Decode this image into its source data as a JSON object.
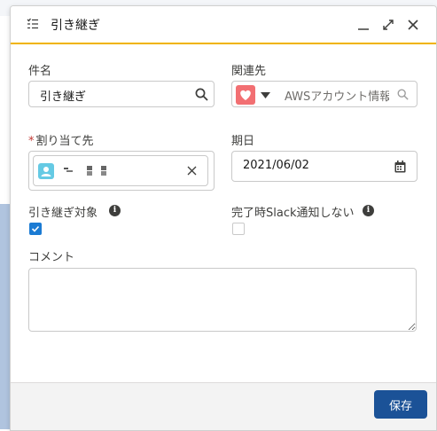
{
  "header": {
    "title": "引き継ぎ"
  },
  "fields": {
    "subject": {
      "label": "件名",
      "value": "引き継ぎ"
    },
    "related": {
      "label": "関連先",
      "value": "AWSアカウント情報"
    },
    "assignee": {
      "label": "割り当て先",
      "required_mark": "*",
      "value": ""
    },
    "due_date": {
      "label": "期日",
      "value": "2021/06/02"
    },
    "handover_target": {
      "label": "引き継ぎ対象",
      "checked": true
    },
    "no_slack": {
      "label": "完了時Slack通知しない",
      "checked": false
    },
    "comment": {
      "label": "コメント",
      "value": ""
    }
  },
  "footer": {
    "save_label": "保存"
  },
  "colors": {
    "accent": "#f0b400",
    "primary": "#1b5297",
    "checkbox": "#1b7bd3",
    "related_icon": "#f26f72"
  }
}
